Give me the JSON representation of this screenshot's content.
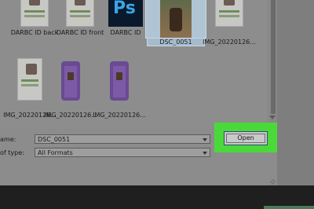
{
  "files": {
    "row1": [
      {
        "label": "DARBC ID back",
        "type": "id-card"
      },
      {
        "label": "DARBC ID front",
        "type": "id-card"
      },
      {
        "label": "DARBC ID",
        "type": "photoshop"
      },
      {
        "label": "DSC_0051",
        "type": "photo",
        "selected": true
      },
      {
        "label": "IMG_20220126...",
        "type": "id-card"
      }
    ],
    "row2": [
      {
        "label": "IMG_20220126...",
        "type": "id-card"
      },
      {
        "label": "IMG_20220126...",
        "type": "id-purple"
      },
      {
        "label": "IMG_20220126...",
        "type": "id-purple"
      }
    ]
  },
  "photoshop_icon_text": "Ps",
  "form": {
    "file_name_label": "ame:",
    "file_name_value": "DSC_0051",
    "file_type_label": "of type:",
    "file_type_value": "All Formats"
  },
  "open_button_label": "Open",
  "highlight_color": "#4bd93a"
}
